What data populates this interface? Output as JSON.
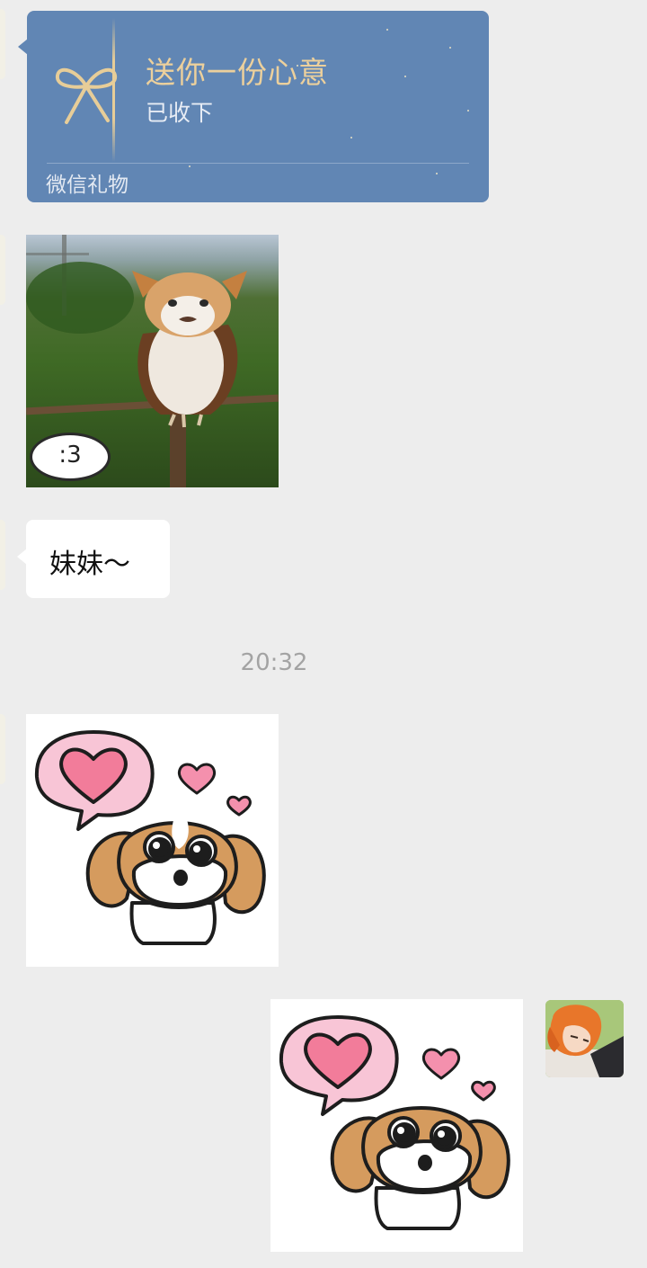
{
  "gift": {
    "title": "送你一份心意",
    "status": "已收下",
    "footer": "微信礼物"
  },
  "photo_sticker": {
    "caption": ":3"
  },
  "message": {
    "text": "妹妹～"
  },
  "timestamp": "20:32",
  "icons": [
    "ribbon-bow-icon"
  ],
  "colors": {
    "background": "#ededed",
    "gift_card": "#6186b4",
    "gift_title": "#ecd09c",
    "bubble": "#ffffff",
    "timestamp": "#a3a3a3"
  }
}
